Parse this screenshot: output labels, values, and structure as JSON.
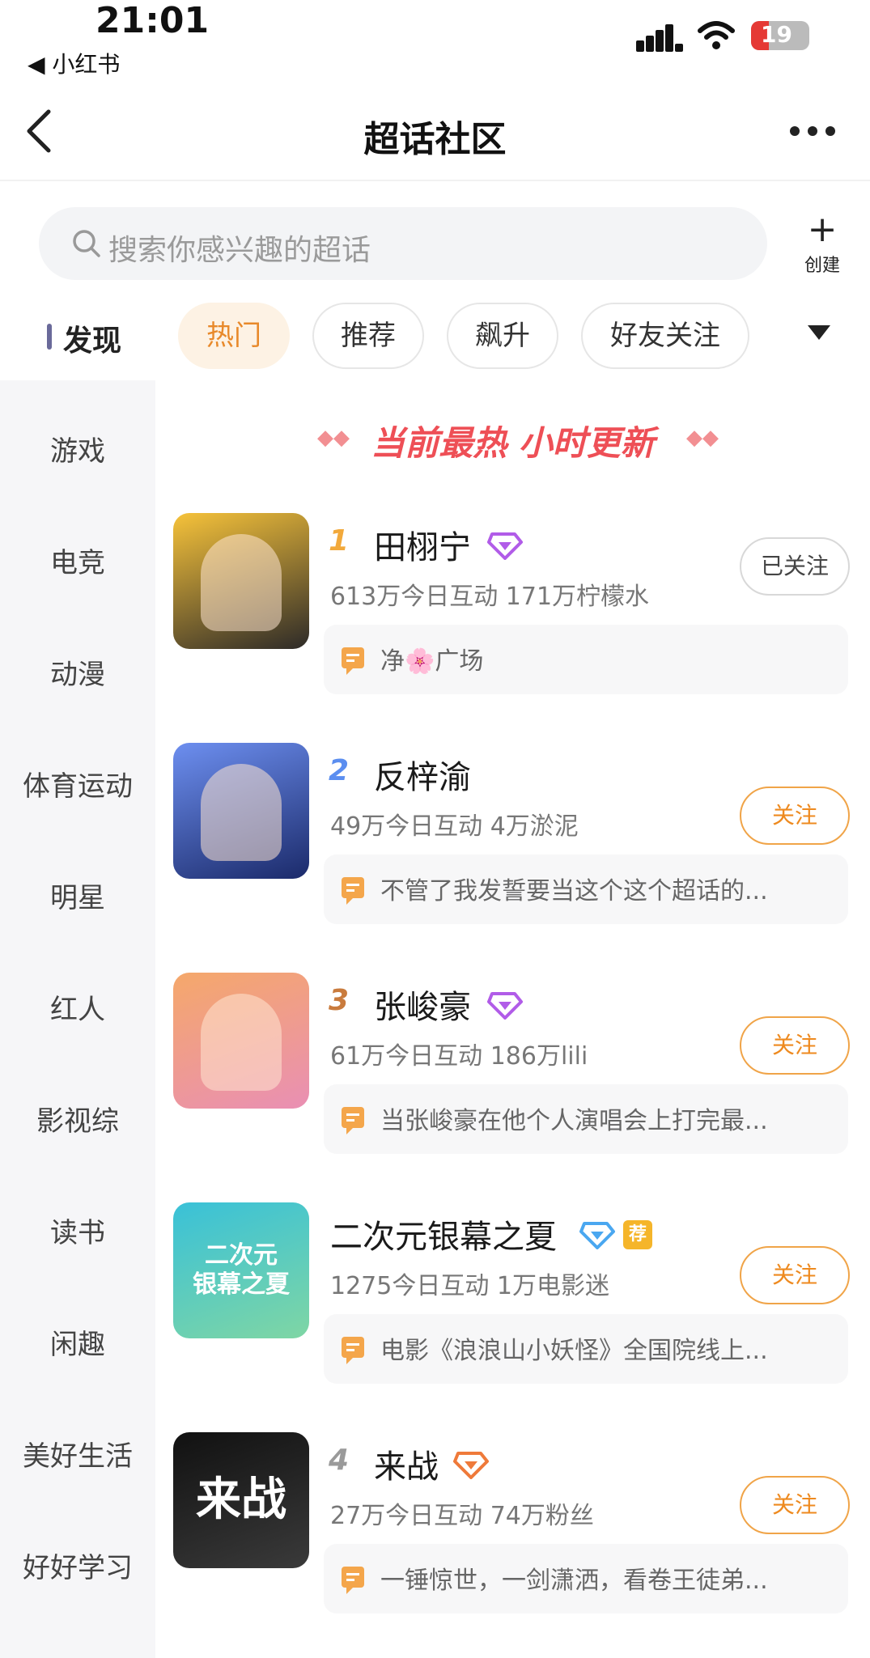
{
  "status_bar": {
    "time": "21:01",
    "back_label": "◀ 小红书",
    "battery": "19"
  },
  "nav": {
    "title": "超话社区"
  },
  "search": {
    "placeholder": "搜索你感兴趣的超话",
    "create_label": "创建"
  },
  "sidebar": {
    "active": "发现",
    "items": [
      "游戏",
      "电竞",
      "动漫",
      "体育运动",
      "明星",
      "红人",
      "影视综",
      "读书",
      "闲趣",
      "美好生活",
      "好好学习"
    ]
  },
  "tabs": [
    "热门",
    "推荐",
    "飙升",
    "好友关注"
  ],
  "banner": {
    "text": "当前最热 小时更新",
    "left_deco": "◆◆",
    "right_deco": "◆◆"
  },
  "list": [
    {
      "rank": "1",
      "name": "田栩宁",
      "stats": "613万今日互动 171万柠檬水",
      "post": "净🌸广场",
      "follow": "已关注",
      "following": true,
      "badge": "purple-diamond-icon",
      "thumb_colors": [
        "#f7c33a",
        "#2d2a28"
      ]
    },
    {
      "rank": "2",
      "name": "反梓渝",
      "stats": "49万今日互动 4万淤泥",
      "post": "不管了我发誓要当这个这个超话的...",
      "follow": "关注",
      "following": false,
      "badge": "",
      "thumb_colors": [
        "#6d8ff0",
        "#1b2a6a"
      ]
    },
    {
      "rank": "3",
      "name": "张峻豪",
      "stats": "61万今日互动 186万lili",
      "post": "当张峻豪在他个人演唱会上打完最...",
      "follow": "关注",
      "following": false,
      "badge": "purple-diamond-icon",
      "thumb_colors": [
        "#f5a86a",
        "#e98fb4"
      ]
    },
    {
      "rank": "",
      "name": "二次元银幕之夏",
      "stats": "1275今日互动 1万电影迷",
      "post": "电影《浪浪山小妖怪》全国院线上...",
      "follow": "关注",
      "following": false,
      "badge": "blue-diamond-icon",
      "tag": "荐",
      "thumb_text": "二次元\n银幕之夏",
      "thumb_colors": [
        "#39c1d8",
        "#7fd6a4"
      ]
    },
    {
      "rank": "4",
      "name": "来战",
      "stats": "27万今日互动 74万粉丝",
      "post": "一锤惊世，一剑潇洒，看卷王徒弟...",
      "follow": "关注",
      "following": false,
      "badge": "orange-diamond-icon",
      "thumb_text": "来战",
      "thumb_colors": [
        "#111111",
        "#3a3a3a"
      ]
    }
  ],
  "colors": {
    "accent": "#ee8a1f",
    "banner": "#ee4f56",
    "rank1": "#f2a93b",
    "rank2": "#5b8ef0",
    "rank3": "#c97b3d",
    "rank4": "#9a9a9a"
  }
}
